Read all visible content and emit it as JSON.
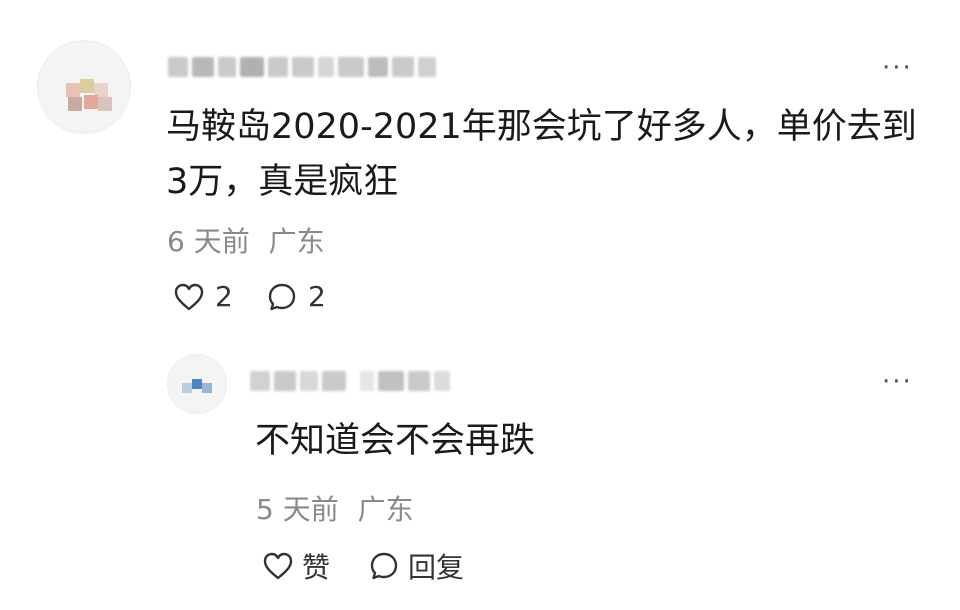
{
  "comment": {
    "content": "马鞍岛2020-2021年那会坑了好多人，单价去到3万，真是疯狂",
    "time": "6 天前",
    "location": "广东",
    "like_icon": "heart-outline-icon",
    "like_count": "2",
    "reply_icon": "comment-bubble-icon",
    "reply_count": "2",
    "more": "···"
  },
  "reply": {
    "content": "不知道会不会再跌",
    "time": "5 天前",
    "location": "广东",
    "like_icon": "heart-outline-icon",
    "like_label": "赞",
    "reply_icon": "comment-bubble-icon",
    "reply_label": "回复",
    "more": "···"
  }
}
